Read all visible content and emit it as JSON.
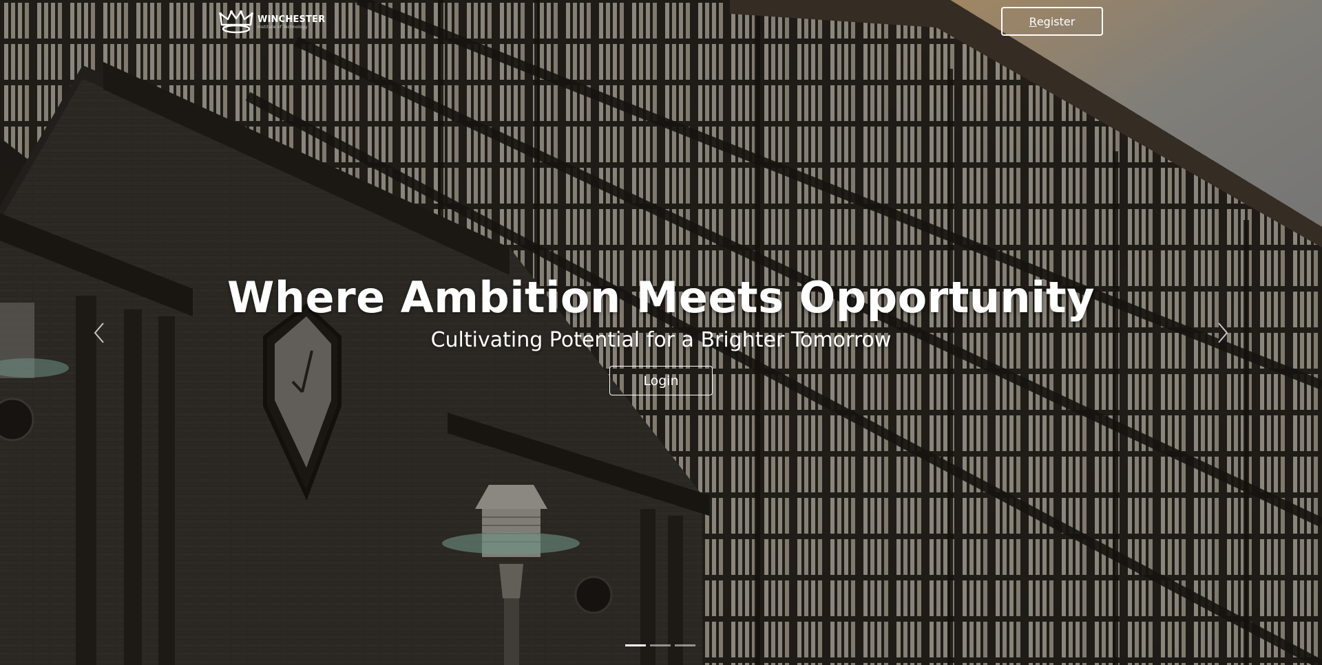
{
  "brand": {
    "name": "WINCHESTER",
    "tagline": "Institute of Technology"
  },
  "header": {
    "register_prefix": "R",
    "register_rest": "egister"
  },
  "hero": {
    "headline": "Where Ambition Meets Opportunity",
    "subheadline": "Cultivating Potential for a Brighter Tomorrow",
    "login_label": "Login"
  },
  "carousel": {
    "slide_count": 3,
    "active_index": 0,
    "prev_icon": "chevron-left-icon",
    "next_icon": "chevron-right-icon"
  },
  "colors": {
    "text": "#ffffff",
    "sunlight": "#ffb05c",
    "facade": "#2a241f"
  }
}
